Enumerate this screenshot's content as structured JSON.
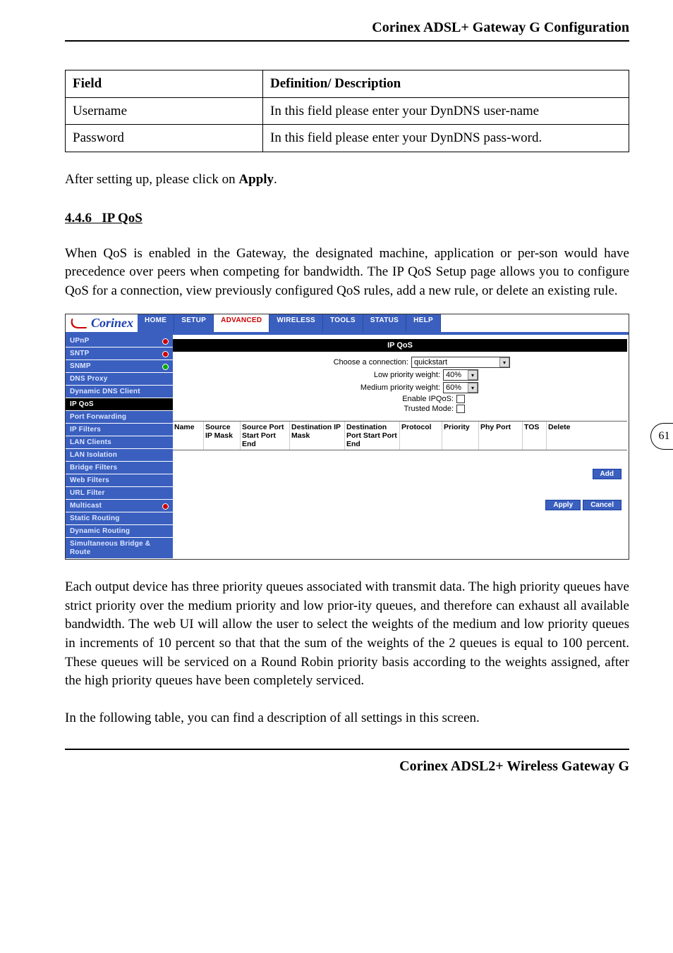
{
  "header_title": "Corinex ADSL+ Gateway G Configuration",
  "footer_title": "Corinex ADSL2+ Wireless Gateway G",
  "page_number": "61",
  "field_table": {
    "head_field": "Field",
    "head_def": "Definition/ Description",
    "rows": [
      {
        "field": "Username",
        "def": "In this field please enter your DynDNS user-name"
      },
      {
        "field": "Password",
        "def": "In this field please enter your DynDNS pass-word."
      }
    ]
  },
  "para_after_setting_pre": "After setting up, please click on ",
  "para_after_setting_bold": "Apply",
  "para_after_setting_post": ".",
  "section_number": "4.4.6",
  "section_title": "IP QoS",
  "para_intro": "When QoS is enabled in the Gateway, the designated machine, application or per-son would have precedence over peers when competing for bandwidth. The IP QoS Setup page allows you to configure QoS for a connection, view previously configured QoS rules, add a new rule, or delete an existing rule.",
  "para_output": "Each output device has three priority queues associated with transmit data. The high priority queues have strict priority over the medium priority and low prior-ity queues, and therefore can exhaust all available bandwidth. The web UI will allow the user to select the weights of the medium and low priority queues in increments of 10 percent so that that the sum of the weights of the 2 queues is equal to 100 percent. These queues will be serviced on a Round Robin priority basis according to the weights assigned, after the high priority queues have been completely serviced.",
  "para_following": "In the following table, you can find a description of all settings in this screen.",
  "ui": {
    "logo_text": "Corinex",
    "tabs": [
      "HOME",
      "SETUP",
      "ADVANCED",
      "WIRELESS",
      "TOOLS",
      "STATUS",
      "HELP"
    ],
    "active_tab_index": 2,
    "sidebar": [
      {
        "label": "UPnP",
        "dot": "red"
      },
      {
        "label": "SNTP",
        "dot": "red"
      },
      {
        "label": "SNMP",
        "dot": "green"
      },
      {
        "label": "DNS Proxy"
      },
      {
        "label": "Dynamic DNS Client"
      },
      {
        "label": "IP QoS",
        "active": true
      },
      {
        "label": "Port Forwarding"
      },
      {
        "label": "IP Filters"
      },
      {
        "label": "LAN Clients"
      },
      {
        "label": "LAN Isolation"
      },
      {
        "label": "Bridge Filters"
      },
      {
        "label": "Web Filters"
      },
      {
        "label": "URL Filter"
      },
      {
        "label": "Multicast",
        "dot": "red"
      },
      {
        "label": "Static Routing"
      },
      {
        "label": "Dynamic Routing"
      },
      {
        "label": "Simultaneous Bridge & Route",
        "multi": true
      }
    ],
    "main_title": "IP QoS",
    "controls": {
      "connection_label": "Choose a connection:",
      "connection_value": "quickstart",
      "low_label": "Low priority weight:",
      "low_value": "40%",
      "med_label": "Medium priority weight:",
      "med_value": "60%",
      "enable_label": "Enable IPQoS:",
      "trusted_label": "Trusted Mode:"
    },
    "grid_headers": [
      "Name",
      "Source IP Mask",
      "Source Port Start Port End",
      "Destination IP Mask",
      "Destination Port Start Port End",
      "Protocol",
      "Priority",
      "Phy Port",
      "TOS",
      "Delete"
    ],
    "btn_add": "Add",
    "btn_apply": "Apply",
    "btn_cancel": "Cancel"
  }
}
